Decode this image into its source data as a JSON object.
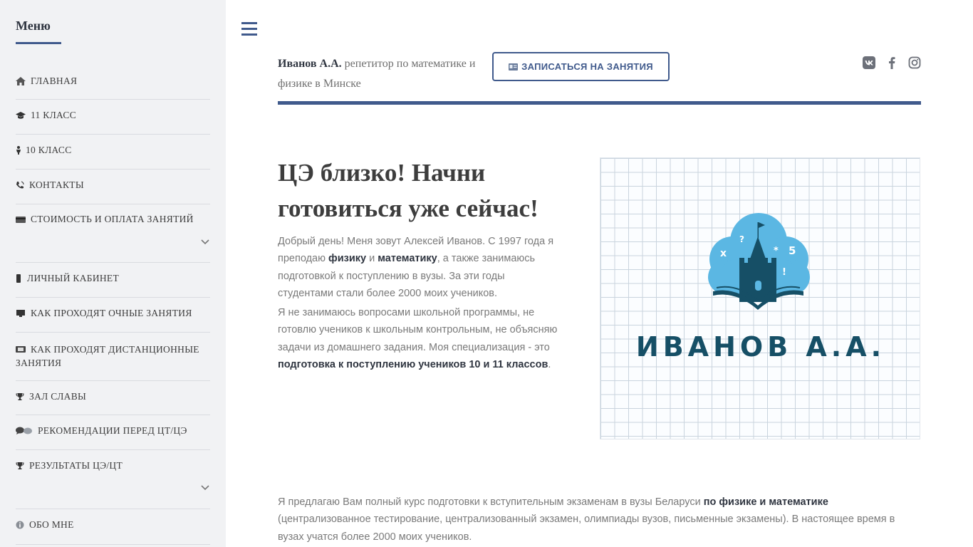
{
  "sidebar": {
    "title": "Меню",
    "items": [
      {
        "label": "ГЛАВНАЯ",
        "icon": "home-icon"
      },
      {
        "label": "11 КЛАСС",
        "icon": "graduation-cap-icon"
      },
      {
        "label": "10 КЛАСС",
        "icon": "person-icon"
      },
      {
        "label": "КОНТАКТЫ",
        "icon": "phone-icon"
      },
      {
        "label": "СТОИМОСТЬ И ОПЛАТА ЗАНЯТИЙ",
        "icon": "credit-card-icon"
      },
      {
        "label": "ЛИЧНЫЙ КАБИНЕТ",
        "icon": "mobile-icon"
      },
      {
        "label": "КАК ПРОХОДЯТ ОЧНЫЕ ЗАНЯТИЯ",
        "icon": "desktop-icon"
      },
      {
        "label": "КАК ПРОХОДЯТ ДИСТАНЦИОННЫЕ ЗАНЯТИЯ",
        "icon": "video-icon"
      },
      {
        "label": "ЗАЛ СЛАВЫ",
        "icon": "trophy-icon"
      },
      {
        "label": "РЕКОМЕНДАЦИИ ПЕРЕД ЦТ/ЦЭ",
        "icon": "speech-bubbles-icon"
      },
      {
        "label": "РЕЗУЛЬТАТЫ ЦЭ/ЦТ",
        "icon": "trophy-icon"
      },
      {
        "label": "ОБО МНЕ",
        "icon": "info-icon"
      }
    ]
  },
  "header": {
    "name": "Иванов А.А.",
    "tagline": " репетитор по математике и физике в Минске",
    "cta_label": "ЗАПИСАТЬСЯ НА ЗАНЯТИЯ",
    "social": [
      "vk-icon",
      "facebook-icon",
      "instagram-icon"
    ]
  },
  "hero": {
    "title": "ЦЭ близко! Начни готовиться уже сейчас!",
    "p1_a": "Добрый день! Меня зовут Алексей Иванов. С 1997 года я преподаю ",
    "p1_b": "физику",
    "p1_c": " и ",
    "p1_d": "математику",
    "p1_e": ", а также занимаюсь подготовкой к поступлению в вузы. За эти годы студентами стали более 2000 моих учеников.",
    "p2_a": "Я не занимаюсь вопросами школьной программы, не готовлю учеников к школьным контрольным, не объясняю задачи из домашнего задания. Моя специализация - это ",
    "p2_b": "подготовка к поступлению учеников 10 и 11 классов",
    "p2_c": ".",
    "logo_text": "ИВАНОВ А.А.",
    "logo_symbols": [
      "x",
      "?",
      "*",
      "5",
      "!"
    ]
  },
  "bottom": {
    "a": "Я предлагаю Вам полный курс подготовки к вступительным экзаменам в вузы Беларуси ",
    "b": "по физике и математике",
    "c": " (централизованное тестирование, централизованный экзамен, олимпиады вузов, письменные экзамены). В настоящее время в вузах учатся более 2000 моих учеников."
  },
  "colors": {
    "accent": "#405a8c",
    "logo_cloud": "#5bb7e3",
    "logo_dark": "#164f66"
  }
}
